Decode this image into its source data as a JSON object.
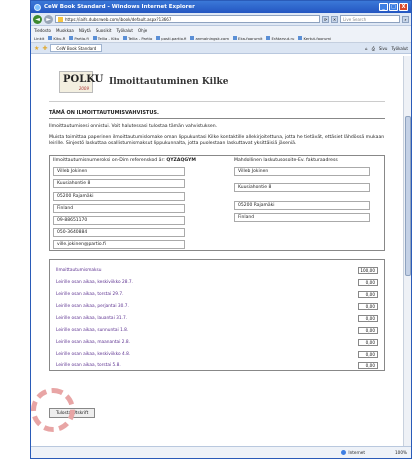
{
  "window": {
    "title": "CeW Book Standard - Windows Internet Explorer",
    "minimize": "_",
    "maximize": "□",
    "close": "X"
  },
  "address": {
    "back": "◄",
    "forward": "►",
    "url": "https://iaifs.dubsrweb.com/ibook/default.aspx?13667",
    "search_placeholder": "Live Search"
  },
  "menu": [
    "Tiedosto",
    "Muokkaa",
    "Näytä",
    "Suosikit",
    "Työkalut",
    "Ohje"
  ],
  "links": {
    "label": "Linkit",
    "items": [
      "Kiku-R",
      "Partio.fi",
      "Tellia - Kiku",
      "Tellia - Partio",
      "posti.partio.fi",
      "anmalningsk.com",
      "Eka-foorumit",
      "Erätarvut.ru",
      "Kertut-foorumi"
    ]
  },
  "tabs": {
    "active": "CeW Book Standard",
    "right": [
      "Sivu",
      "Työkalut"
    ]
  },
  "page": {
    "logo_text": "POLKU",
    "logo_sub": "2009",
    "title": "Ilmoittautuminen Kilke",
    "confirm_heading": "TÄMÄ ON ILMOITTAUTUMISVAHVISTUS.",
    "para1": "Ilmoittautumisesi onnistui. Voit halutessasi tulostaa tämän vahvistuksen.",
    "para2": "Muista toimittaa paperinen ilmoittautumislomake oman lippukuntasi Kilke kontaktille allekirjoitettuna, jotta he tietävät, ettäsiet lähdössä mukaan leirille. Sinjestö laskuttaa osallistumismaksut lippukunnalta, jotta puolestaan laskuttavat yksittäisiä jäseniä.",
    "ref_label": "Ilmoittautumisnumeroksi on-Dim referenskod är:",
    "ref_code": "QYZAQGYM",
    "delivery_label": "Mahdollinen laskutusosoite-Ev. fakturaadress",
    "left_fields": [
      "Villeb Jokinen",
      "Kuusiahontie 8",
      "05200 Rajamäki",
      "Finland",
      "09-88651170",
      "050-3640884",
      "ville.jokinen@partio.fi"
    ],
    "right_fields": [
      "Villeb Jokinen",
      "Kuusiahontie 8",
      "05200 Rajamäki",
      "Finland"
    ],
    "items": [
      {
        "label": "Ilmoittautumismaksu",
        "value": "100,00"
      },
      {
        "label": "Leirille osan aikaa, keskiviikko 28.7.",
        "value": "0,00"
      },
      {
        "label": "Leirille osan aikaa, torstai 29.7.",
        "value": "0,00"
      },
      {
        "label": "Leirille osan aikaa, perjantai 30.7.",
        "value": "0,00"
      },
      {
        "label": "Leirille osan aikaa, lauantai 31.7.",
        "value": "0,00"
      },
      {
        "label": "Leirille osan aikaa, sunnuntai 1.8.",
        "value": "0,00"
      },
      {
        "label": "Leirille osan aikaa, maanantai 2.8.",
        "value": "0,00"
      },
      {
        "label": "Leirille osan aikaa, keskiviikko 4.8.",
        "value": "0,00"
      },
      {
        "label": "Leirille osan aikaa, torstai 5.8.",
        "value": "0,00"
      }
    ],
    "print_button": "Tulosta-Utskrift"
  },
  "status": {
    "zone": "Internet",
    "zoom": "100%"
  }
}
